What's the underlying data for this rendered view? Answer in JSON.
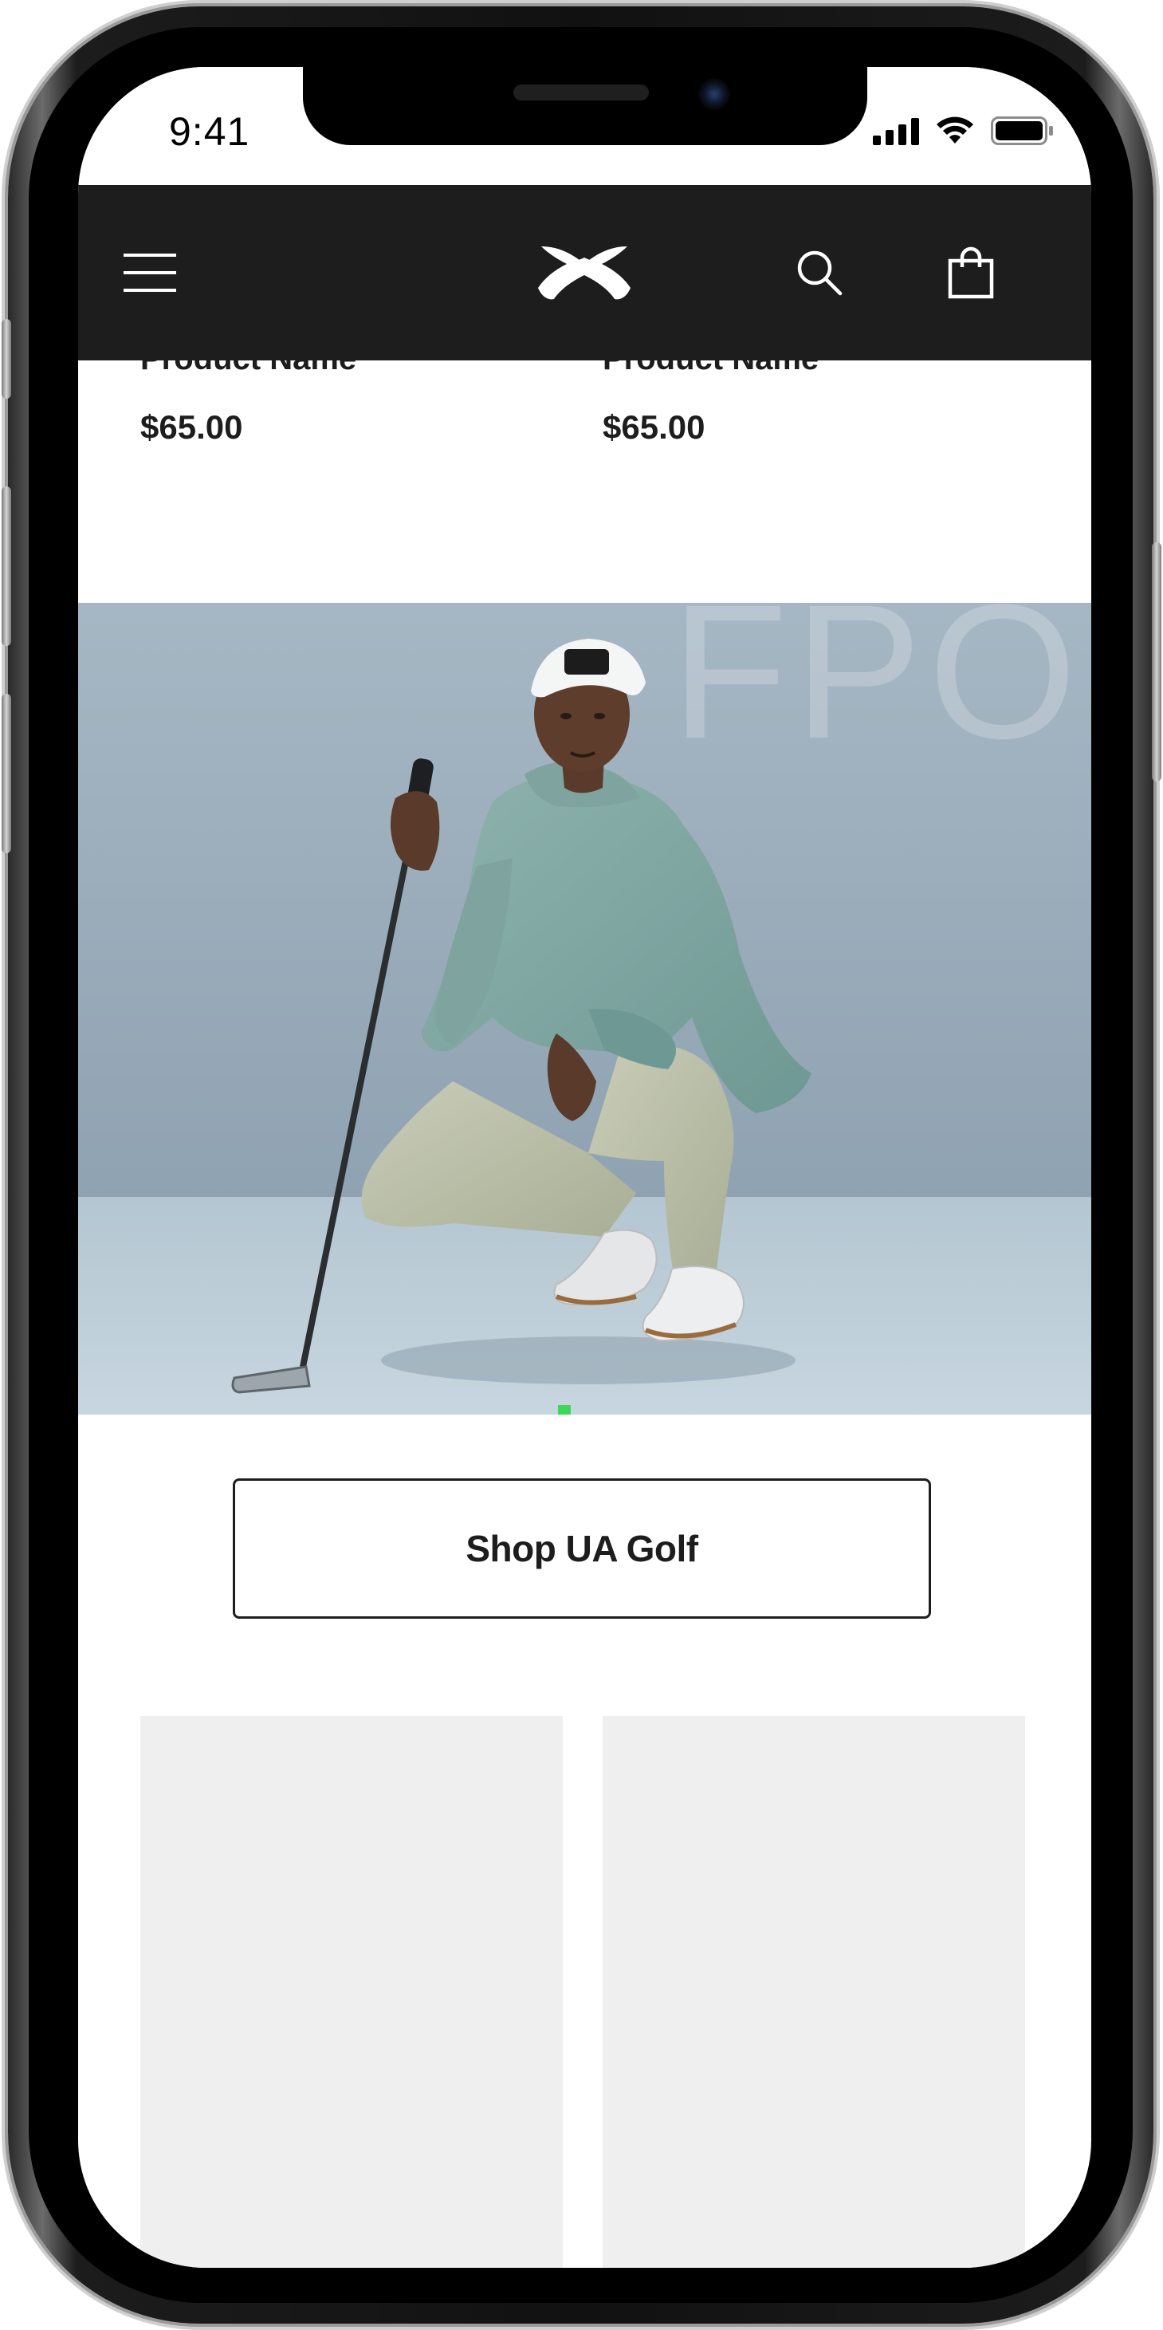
{
  "status_bar": {
    "time": "9:41"
  },
  "nav": {
    "menu_icon": "hamburger-menu-icon",
    "logo_icon": "under-armour-logo",
    "search_icon": "search-icon",
    "bag_icon": "shopping-bag-icon"
  },
  "products_top": [
    {
      "name": "Product Name",
      "price": "$65.00"
    },
    {
      "name": "Product Name",
      "price": "$65.00"
    }
  ],
  "hero": {
    "watermark": "FPO"
  },
  "cta": {
    "label": "Shop UA Golf"
  },
  "colors": {
    "nav_background": "#1d1d1d",
    "text": "#1d1d1d",
    "placeholder_tile": "#efefef",
    "hero_background": "#9fb0bd"
  }
}
